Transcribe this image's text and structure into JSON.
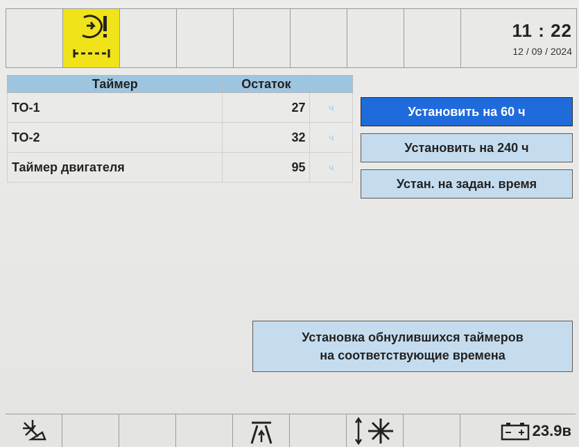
{
  "header": {
    "time": "11 : 22",
    "date": "12 / 09 / 2024",
    "active_icon": "maintenance-warning-icon"
  },
  "table": {
    "headers": [
      "Таймер",
      "Остаток",
      ""
    ],
    "rows": [
      {
        "name": "ТО-1",
        "value": "27",
        "unit": "ч"
      },
      {
        "name": "ТО-2",
        "value": "32",
        "unit": "ч"
      },
      {
        "name": "Таймер двигателя",
        "value": "95",
        "unit": "ч"
      }
    ]
  },
  "actions": {
    "set_60": "Установить на 60 ч",
    "set_240": "Установить на 240 ч",
    "set_custom": "Устан. на задан. время",
    "reset_line1": "Установка обнулившихся таймеров",
    "reset_line2": "на соответствующие времена"
  },
  "footer": {
    "battery_voltage": "23.9в",
    "icons": [
      "work-light-icon",
      "road-mode-icon",
      "joystick-icon",
      "battery-icon"
    ]
  },
  "colors": {
    "active_cell": "#f1e319",
    "table_header": "#9ec5e0",
    "primary_button": "#1f6bdc",
    "secondary_button": "#c5dcee"
  }
}
